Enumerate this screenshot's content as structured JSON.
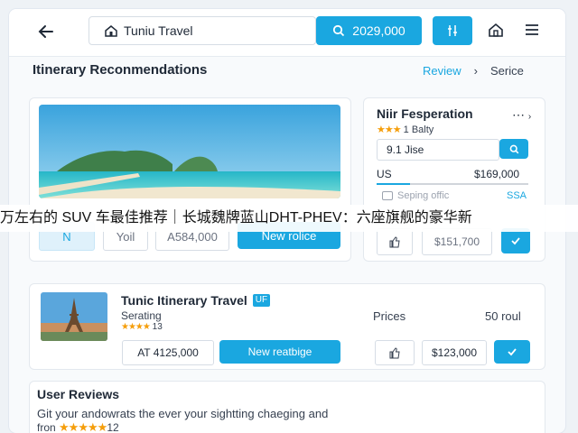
{
  "header": {
    "location": "Tuniu Travel",
    "search_value": "2029,000"
  },
  "section": {
    "title": "Itinerary Reconmendations",
    "crumb_review": "Review",
    "crumb_service": "Serice"
  },
  "card1": {
    "field_price": "A584,000",
    "field_small": "Yoil",
    "field_blue": "N",
    "new_button": "New rolice"
  },
  "side": {
    "title": "Niir Fesperation",
    "rating": "1 Balty",
    "stars": "★★★",
    "input_value": "9.1 Jise",
    "currency": "US",
    "amount": "$169,000",
    "shipping": "Seping offic",
    "shipping_code": "SSA",
    "price_field": "$151,700"
  },
  "card2": {
    "title": "Tunic Itinerary Travel",
    "badge": "UF",
    "subtitle": "Serating",
    "stars": "★★★★",
    "rating": "13",
    "prices_label": "Prices",
    "prices_value": "50 roul",
    "field_value": "AT 4125,000",
    "new_button": "New reatbige",
    "price_field": "$123,000"
  },
  "reviews": {
    "title": "User Reviews",
    "line1": "Git your andowrats the ever your sightting chaeging and",
    "line2_prefix": "fron",
    "stars": "★★★★★",
    "count": "12"
  },
  "banner": {
    "text": "万左右的 SUV 车最佳推荐｜长城魏牌蓝山DHT-PHEV：六座旗舰的豪华新"
  },
  "colors": {
    "accent": "#1aa7e0",
    "star": "#f59e0b",
    "text": "#1f2937"
  }
}
